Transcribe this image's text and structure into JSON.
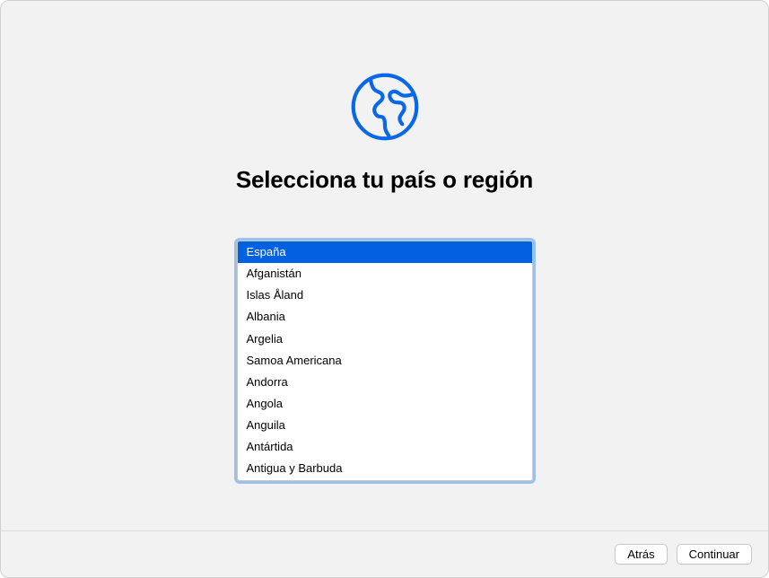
{
  "title": "Selecciona tu país o región",
  "icon_name": "globe-icon",
  "countries": [
    {
      "name": "España",
      "selected": true
    },
    {
      "name": "Afganistán",
      "selected": false
    },
    {
      "name": "Islas Åland",
      "selected": false
    },
    {
      "name": "Albania",
      "selected": false
    },
    {
      "name": "Argelia",
      "selected": false
    },
    {
      "name": "Samoa Americana",
      "selected": false
    },
    {
      "name": "Andorra",
      "selected": false
    },
    {
      "name": "Angola",
      "selected": false
    },
    {
      "name": "Anguila",
      "selected": false
    },
    {
      "name": "Antártida",
      "selected": false
    },
    {
      "name": "Antigua y Barbuda",
      "selected": false
    }
  ],
  "footer": {
    "back_label": "Atrás",
    "continue_label": "Continuar"
  }
}
